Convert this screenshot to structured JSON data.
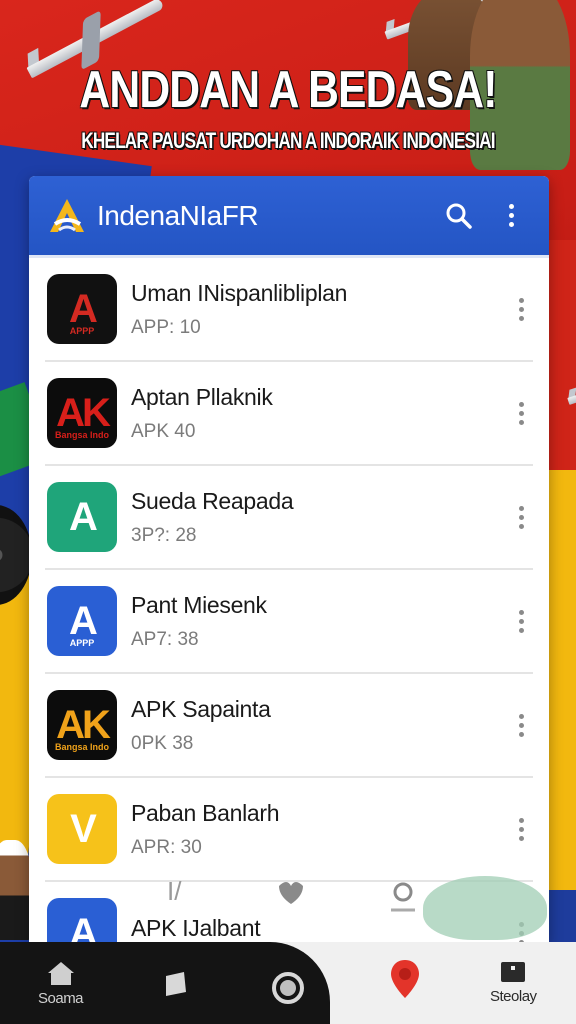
{
  "banner": {
    "headline": "ANDDAN A BEDASA!",
    "subheadline": "KHELAR PAUSAT URDOHAN A INDORAIK INDONESIAI"
  },
  "appbar": {
    "title": "IndenaNIaFR",
    "search_icon": "search-icon",
    "menu_icon": "more-vert-icon",
    "accent_color": "#2455c4"
  },
  "apps": [
    {
      "title": "Uman INispanlibliplan",
      "subtitle": "APP: 10",
      "icon_text": "A",
      "icon_caption": "APPP",
      "icon_bg": "#111111",
      "icon_fg": "#d42a22"
    },
    {
      "title": "Aptan Pllaknik",
      "subtitle": "APK 40",
      "icon_text": "AK",
      "icon_caption": "Bangsa Indo",
      "icon_bg": "#0c0c0c",
      "icon_fg": "#d81f1a"
    },
    {
      "title": "Sueda Reapada",
      "subtitle": "3P?: 28",
      "icon_text": "A",
      "icon_caption": "",
      "icon_bg": "#1fa57a",
      "icon_fg": "#ffffff"
    },
    {
      "title": "Pant Miesenk",
      "subtitle": "AP7: 38",
      "icon_text": "A",
      "icon_caption": "APPP",
      "icon_bg": "#2a5fd4",
      "icon_fg": "#ffffff"
    },
    {
      "title": "APK Sapainta",
      "subtitle": "0PK 38",
      "icon_text": "AK",
      "icon_caption": "Bangsa Indo",
      "icon_bg": "#0c0c0c",
      "icon_fg": "#f0a21a"
    },
    {
      "title": "Paban Banlarh",
      "subtitle": "APR: 30",
      "icon_text": "V",
      "icon_caption": "",
      "icon_bg": "#f6c21a",
      "icon_fg": "#ffffff"
    },
    {
      "title": "APK IJalbant",
      "subtitle": "",
      "icon_text": "A",
      "icon_caption": "",
      "icon_bg": "#2a5fd4",
      "icon_fg": "#ffffff"
    }
  ],
  "bottom_nav": {
    "home_label": "Soama",
    "stats_label": "Steolay"
  }
}
